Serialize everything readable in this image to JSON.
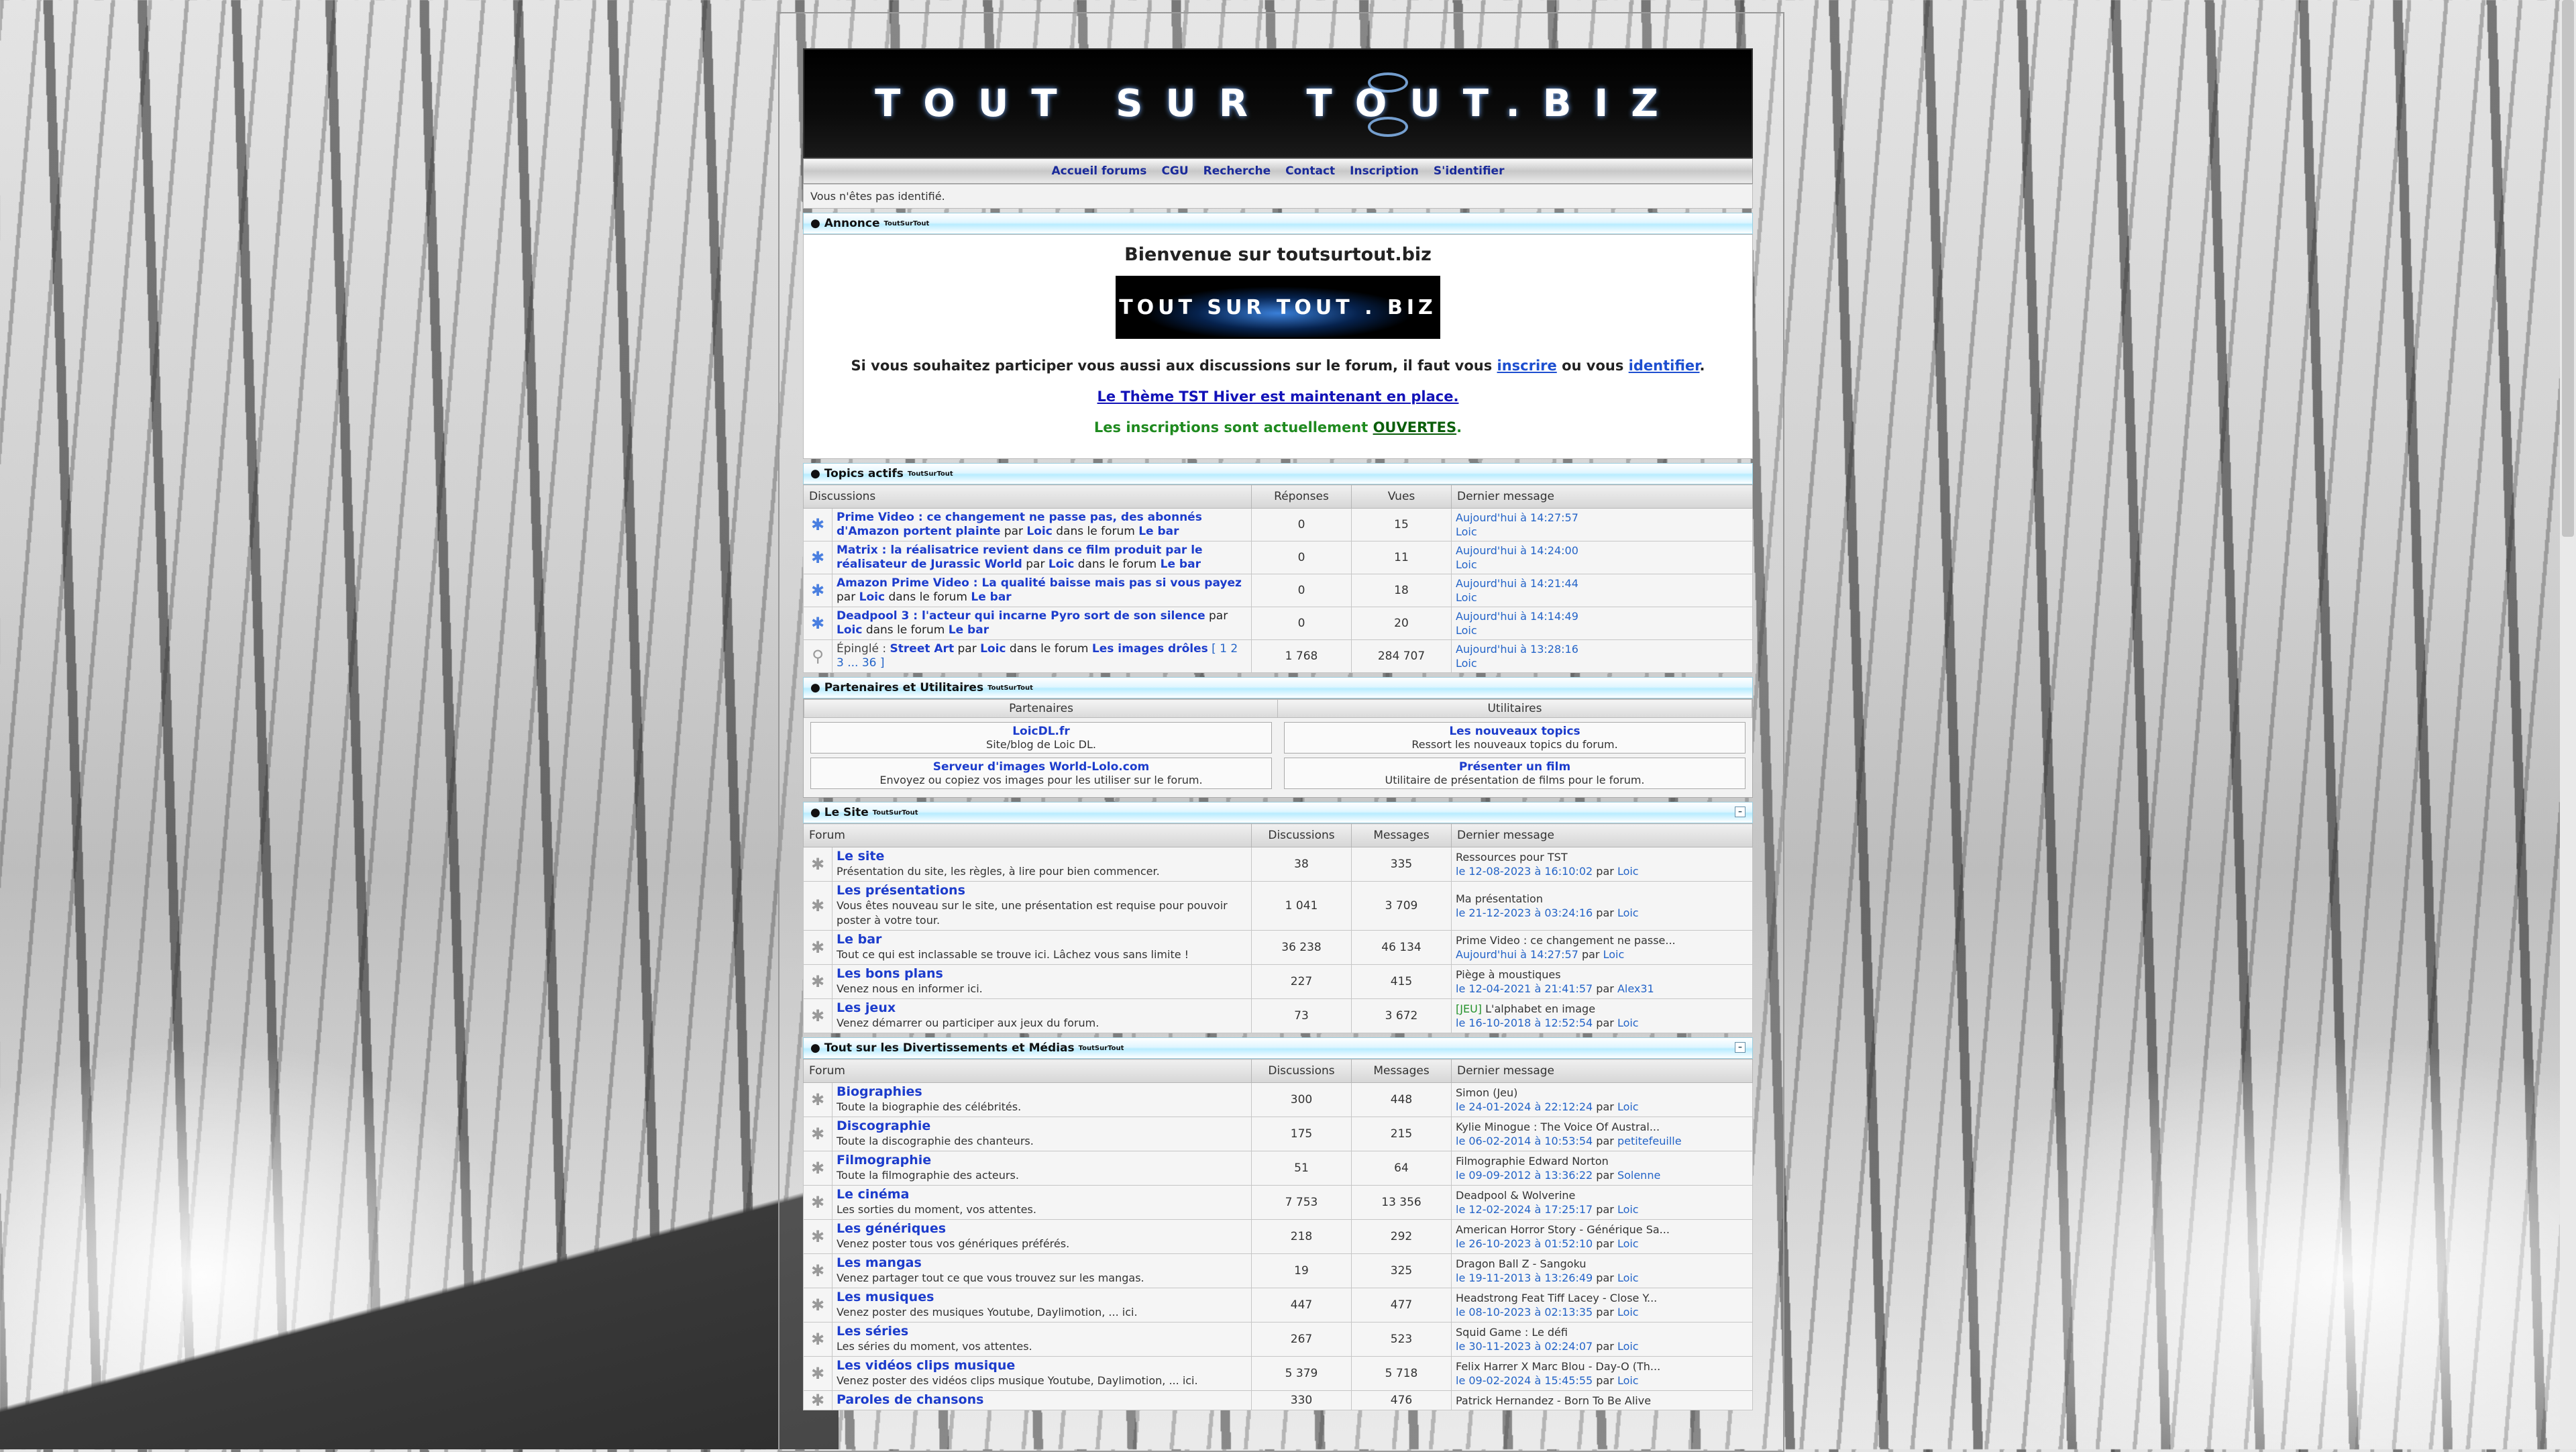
{
  "banner": {
    "text": "TOUT SUR TOUT.BIZ"
  },
  "nav": [
    "Accueil forums",
    "CGU",
    "Recherche",
    "Contact",
    "Inscription",
    "S'identifier"
  ],
  "ident": "Vous n'êtes pas identifié.",
  "announce": {
    "header": "Annonce",
    "sup": "ToutSurTout",
    "welcome": "Bienvenue sur toutsurtout.biz",
    "logo": "TOUT SUR TOUT . BIZ",
    "line1_pre": "Si vous souhaitez participer vous aussi aux discussions sur le forum, il faut vous",
    "line1_link1": "inscrire",
    "line1_mid": "ou vous",
    "line1_link2": "identifier",
    "line1_end": ".",
    "line2": "Le Thème TST Hiver est maintenant en place.",
    "line3_pre": "Les inscriptions sont actuellement",
    "line3_link": "OUVERTES",
    "line3_end": "."
  },
  "active": {
    "header": "Topics actifs",
    "sup": "ToutSurTout",
    "cols": [
      "Discussions",
      "Réponses",
      "Vues",
      "Dernier message"
    ],
    "rows": [
      {
        "title": "Prime Video : ce changement ne passe pas, des abonnés d'Amazon portent plainte",
        "by": "par",
        "user": "Loic",
        "in": "dans le forum",
        "forum": "Le bar",
        "replies": "0",
        "views": "15",
        "date": "Aujourd'hui à 14:27:57",
        "last_user": "Loic"
      },
      {
        "title": "Matrix : la réalisatrice revient dans ce film produit par le réalisateur de Jurassic World",
        "by": "par",
        "user": "Loic",
        "in": "dans le forum",
        "forum": "Le bar",
        "replies": "0",
        "views": "11",
        "date": "Aujourd'hui à 14:24:00",
        "last_user": "Loic"
      },
      {
        "title": "Amazon Prime Video : La qualité baisse mais pas si vous payez",
        "by": "par",
        "user": "Loic",
        "in": "dans le forum",
        "forum": "Le bar",
        "replies": "0",
        "views": "18",
        "date": "Aujourd'hui à 14:21:44",
        "last_user": "Loic"
      },
      {
        "title": "Deadpool 3 : l'acteur qui incarne Pyro sort de son silence",
        "by": "par",
        "user": "Loic",
        "in": "dans le forum",
        "forum": "Le bar",
        "replies": "0",
        "views": "20",
        "date": "Aujourd'hui à 14:14:49",
        "last_user": "Loic"
      }
    ],
    "pinned": {
      "prefix": "Épinglé :",
      "title": "Street Art",
      "by": "par",
      "user": "Loic",
      "in": "dans le forum",
      "forum": "Les images drôles",
      "pages": "[ 1 2 3 ... 36 ]",
      "replies": "1 768",
      "views": "284 707",
      "date": "Aujourd'hui à 13:28:16",
      "last_user": "Loic"
    }
  },
  "partners": {
    "header": "Partenaires et Utilitaires",
    "sup": "ToutSurTout",
    "col1": "Partenaires",
    "col2": "Utilitaires",
    "p": [
      {
        "title": "LoicDL.fr",
        "desc": "Site/blog de Loic DL."
      },
      {
        "title": "Serveur d'images World-Lolo.com",
        "desc": "Envoyez ou copiez vos images pour les utiliser sur le forum."
      }
    ],
    "u": [
      {
        "title": "Les nouveaux topics",
        "desc": "Ressort les nouveaux topics du forum."
      },
      {
        "title": "Présenter un film",
        "desc": "Utilitaire de présentation de films pour le forum."
      }
    ]
  },
  "site": {
    "header": "Le Site",
    "sup": "ToutSurTout",
    "cols": [
      "Forum",
      "Discussions",
      "Messages",
      "Dernier message"
    ],
    "rows": [
      {
        "name": "Le site",
        "desc": "Présentation du site, les règles, à lire pour bien commencer.",
        "topics": "38",
        "posts": "335",
        "last_title": "Ressources pour TST",
        "date": "le 12-08-2023 à 16:10:02",
        "by": "par",
        "user": "Loic"
      },
      {
        "name": "Les présentations",
        "desc": "Vous êtes nouveau sur le site, une présentation est requise pour pouvoir poster à votre tour.",
        "topics": "1 041",
        "posts": "3 709",
        "last_title": "Ma présentation",
        "date": "le 21-12-2023 à 03:24:16",
        "by": "par",
        "user": "Loic"
      },
      {
        "name": "Le bar",
        "desc": "Tout ce qui est inclassable se trouve ici. Lâchez vous sans limite !",
        "topics": "36 238",
        "posts": "46 134",
        "last_title": "Prime Video : ce changement ne passe...",
        "date": "Aujourd'hui à 14:27:57",
        "by": "par",
        "user": "Loic"
      },
      {
        "name": "Les bons plans",
        "desc": "Venez nous en informer ici.",
        "topics": "227",
        "posts": "415",
        "last_title": "Piège à moustiques",
        "date": "le 12-04-2021 à 21:41:57",
        "by": "par",
        "user": "Alex31"
      },
      {
        "name": "Les jeux",
        "desc": "Venez démarrer ou participer aux jeux du forum.",
        "topics": "73",
        "posts": "3 672",
        "last_tag": "[JEU]",
        "last_title": "L'alphabet en image",
        "date": "le 16-10-2018 à 12:52:54",
        "by": "par",
        "user": "Loic"
      }
    ]
  },
  "media": {
    "header": "Tout sur les Divertissements et Médias",
    "sup": "ToutSurTout",
    "cols": [
      "Forum",
      "Discussions",
      "Messages",
      "Dernier message"
    ],
    "rows": [
      {
        "name": "Biographies",
        "desc": "Toute la biographie des célébrités.",
        "topics": "300",
        "posts": "448",
        "last_title": "Simon (Jeu)",
        "date": "le 24-01-2024 à 22:12:24",
        "by": "par",
        "user": "Loic"
      },
      {
        "name": "Discographie",
        "desc": "Toute la discographie des chanteurs.",
        "topics": "175",
        "posts": "215",
        "last_title": "Kylie Minogue : The Voice Of Austral...",
        "date": "le 06-02-2014 à 10:53:54",
        "by": "par",
        "user": "petitefeuille"
      },
      {
        "name": "Filmographie",
        "desc": "Toute la filmographie des acteurs.",
        "topics": "51",
        "posts": "64",
        "last_title": "Filmographie Edward Norton",
        "date": "le 09-09-2012 à 13:36:22",
        "by": "par",
        "user": "Solenne"
      },
      {
        "name": "Le cinéma",
        "desc": "Les sorties du moment, vos attentes.",
        "topics": "7 753",
        "posts": "13 356",
        "last_title": "Deadpool & Wolverine",
        "date": "le 12-02-2024 à 17:25:17",
        "by": "par",
        "user": "Loic"
      },
      {
        "name": "Les génériques",
        "desc": "Venez poster tous vos génériques préférés.",
        "topics": "218",
        "posts": "292",
        "last_title": "American Horror Story - Générique Sa...",
        "date": "le 26-10-2023 à 01:52:10",
        "by": "par",
        "user": "Loic"
      },
      {
        "name": "Les mangas",
        "desc": "Venez partager tout ce que vous trouvez sur les mangas.",
        "topics": "19",
        "posts": "325",
        "last_title": "Dragon Ball Z - Sangoku",
        "date": "le 19-11-2013 à 13:26:49",
        "by": "par",
        "user": "Loic"
      },
      {
        "name": "Les musiques",
        "desc": "Venez poster des musiques Youtube, Daylimotion, ... ici.",
        "topics": "447",
        "posts": "477",
        "last_title": "Headstrong Feat Tiff Lacey - Close Y...",
        "date": "le 08-10-2023 à 02:13:35",
        "by": "par",
        "user": "Loic"
      },
      {
        "name": "Les séries",
        "desc": "Les séries du moment, vos attentes.",
        "topics": "267",
        "posts": "523",
        "last_title": "Squid Game : Le défi",
        "date": "le 30-11-2023 à 02:24:07",
        "by": "par",
        "user": "Loic"
      },
      {
        "name": "Les vidéos clips musique",
        "desc": "Venez poster des vidéos clips musique Youtube, Daylimotion, ... ici.",
        "topics": "5 379",
        "posts": "5 718",
        "last_title": "Felix Harrer X Marc Blou - Day-O (Th...",
        "date": "le 09-02-2024 à 15:45:55",
        "by": "par",
        "user": "Loic"
      },
      {
        "name": "Paroles de chansons",
        "desc": "",
        "topics": "330",
        "posts": "476",
        "last_title": "Patrick Hernandez - Born To Be Alive",
        "date": "",
        "by": "",
        "user": ""
      }
    ]
  }
}
